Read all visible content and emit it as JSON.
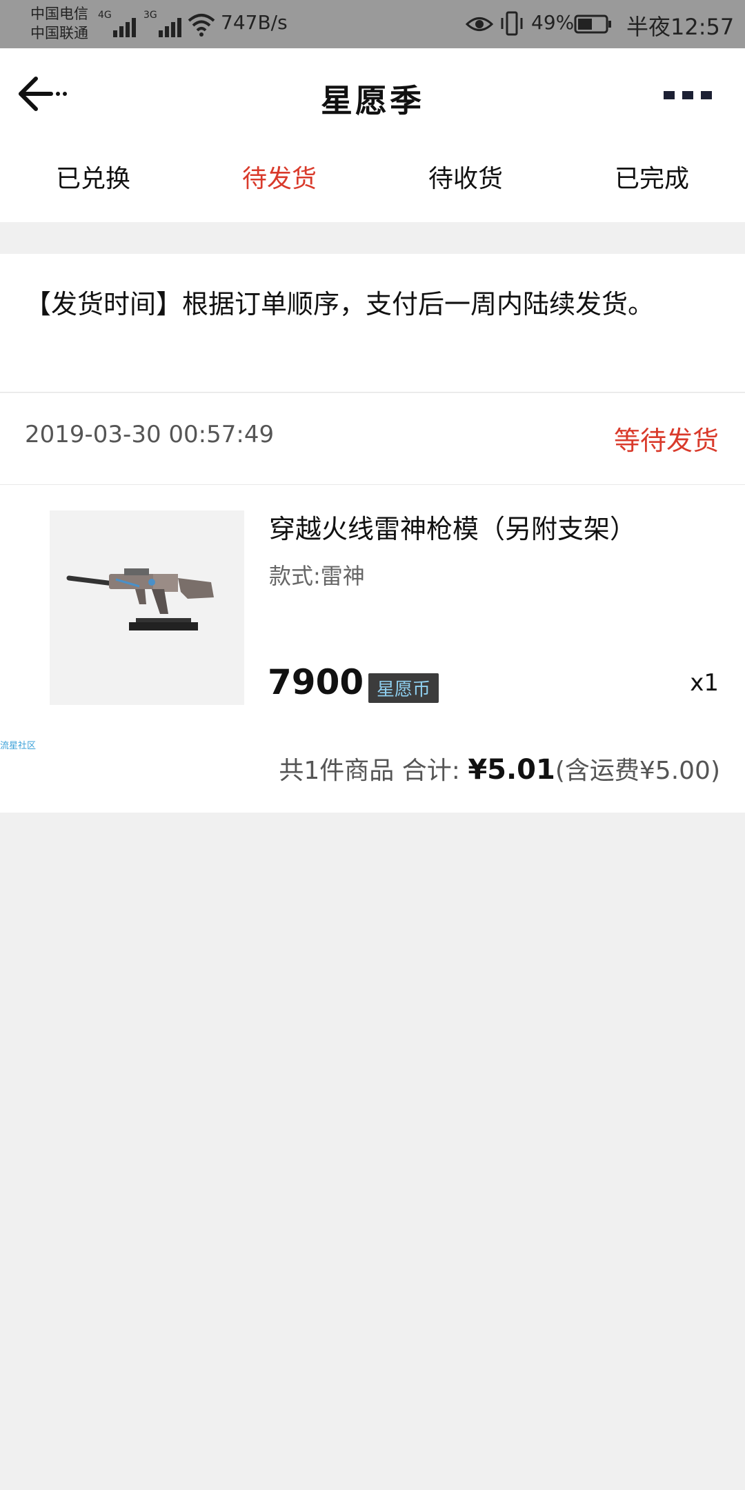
{
  "status_bar": {
    "carrier_1": "中国电信",
    "carrier_2": "中国联通",
    "net_1": "4G",
    "net_2": "3G",
    "speed": "747B/s",
    "battery_pct": "49%",
    "time": "半夜12:57"
  },
  "header": {
    "title": "星愿季"
  },
  "tabs": [
    {
      "label": "已兑换"
    },
    {
      "label": "待发货"
    },
    {
      "label": "待收货"
    },
    {
      "label": "已完成"
    }
  ],
  "notice": {
    "text": "【发货时间】根据订单顺序，支付后一周内陆续发货。"
  },
  "order": {
    "time": "2019-03-30 00:57:49",
    "status": "等待发货",
    "product_name": "穿越火线雷神枪模（另附支架）",
    "style": "款式:雷神",
    "price": "7900",
    "currency": "星愿币",
    "quantity": "x1",
    "summary_prefix": "共1件商品 合计: ",
    "total": "¥5.01",
    "shipping": "(含运费¥5.00)",
    "community_tag": "流星社区"
  },
  "colors": {
    "accent": "#d93a2b",
    "status_bar": "#9a9a9a",
    "page_bg": "#f0f0f0"
  }
}
